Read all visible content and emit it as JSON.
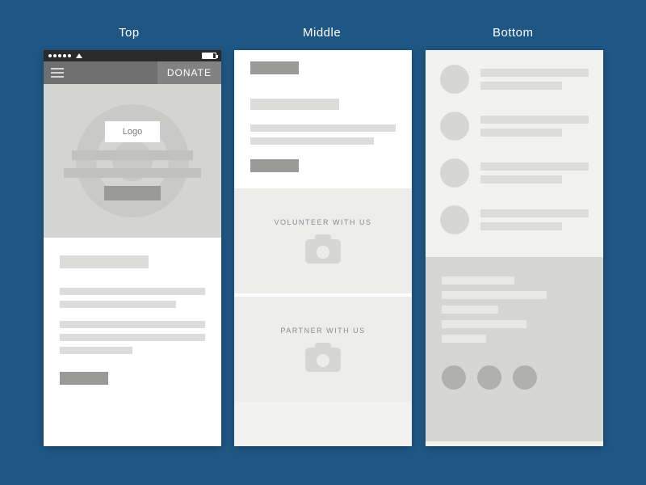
{
  "labels": {
    "top": "Top",
    "middle": "Middle",
    "bottom": "Bottom"
  },
  "topFrame": {
    "donate": "DONATE",
    "logo": "Logo"
  },
  "middleFrame": {
    "card1": "VOLUNTEER WITH US",
    "card2": "PARTNER WITH US"
  }
}
